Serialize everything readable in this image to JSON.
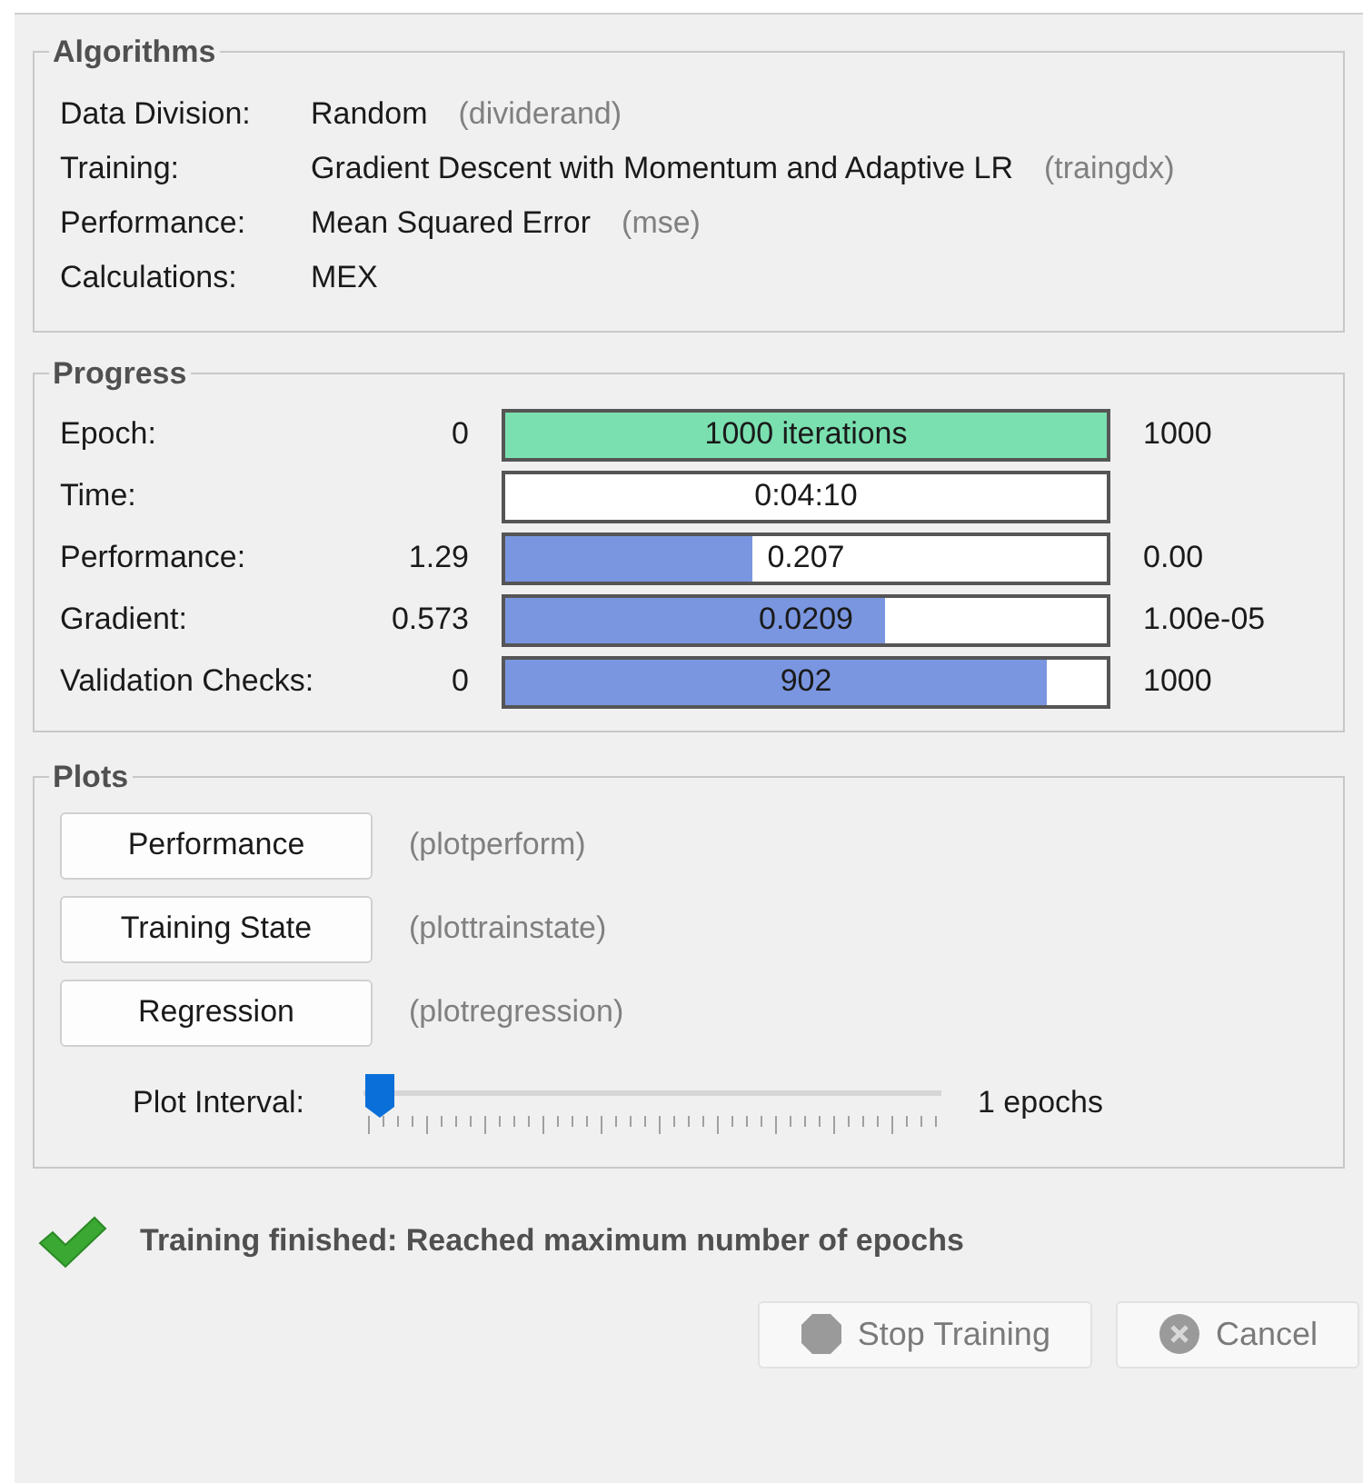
{
  "algorithms": {
    "title": "Algorithms",
    "rows": [
      {
        "label": "Data Division:",
        "value": "Random",
        "function": "(dividerand)"
      },
      {
        "label": "Training:",
        "value": "Gradient Descent with Momentum and Adaptive LR",
        "function": "(traingdx)"
      },
      {
        "label": "Performance:",
        "value": "Mean Squared Error",
        "function": "(mse)"
      },
      {
        "label": "Calculations:",
        "value": "MEX"
      }
    ]
  },
  "progress": {
    "title": "Progress",
    "rows": [
      {
        "label": "Epoch:",
        "start": "0",
        "bar_text": "1000 iterations",
        "level": 1,
        "color": "#7ae0b0",
        "end": "1000"
      },
      {
        "label": "Time:",
        "bar_text": "0:04:10"
      },
      {
        "label": "Performance:",
        "start": "1.29",
        "bar_text": "0.207",
        "level": 0.41,
        "color": "#7a96e0",
        "end": "0.00"
      },
      {
        "label": "Gradient:",
        "start": "0.573",
        "bar_text": "0.0209",
        "level": 0.63,
        "color": "#7a96e0",
        "end": "1.00e-05"
      },
      {
        "label": "Validation Checks:",
        "start": "0",
        "bar_text": "902",
        "level": 0.9,
        "color": "#7a96e0",
        "end": "1000"
      }
    ]
  },
  "plots": {
    "title": "Plots",
    "buttons": [
      {
        "label": "Performance",
        "function": "(plotperform)"
      },
      {
        "label": "Training State",
        "function": "(plottrainstate)"
      },
      {
        "label": "Regression",
        "function": "(plotregression)"
      }
    ],
    "interval": {
      "label": "Plot Interval:",
      "level": 0,
      "reading": "1 epochs"
    }
  },
  "status": {
    "text": "Training finished: Reached maximum number of epochs"
  },
  "buttons": [
    {
      "label": "Stop Training",
      "kind": "stop",
      "disabled": true
    },
    {
      "label": "Cancel",
      "kind": "cancel",
      "disabled": true
    }
  ]
}
